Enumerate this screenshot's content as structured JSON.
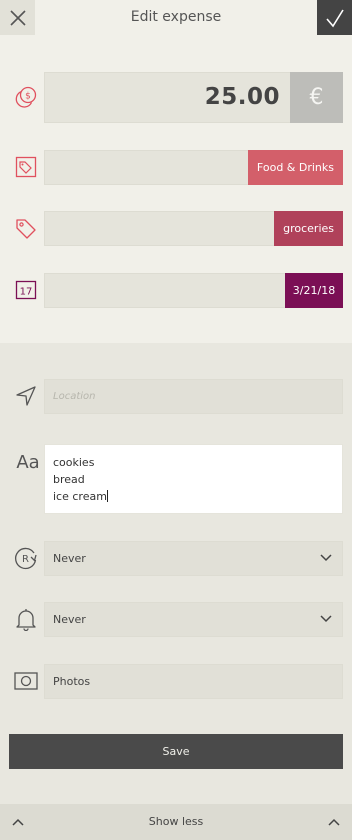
{
  "header": {
    "title": "Edit expense"
  },
  "amount": {
    "value": "25.00",
    "currency_symbol": "€"
  },
  "category": {
    "label": "Food & Drinks"
  },
  "tag": {
    "label": "groceries"
  },
  "date": {
    "label": "3/21/18"
  },
  "location": {
    "placeholder": "Location",
    "value": ""
  },
  "notes": {
    "icon_text": "Aa",
    "lines": [
      "cookies",
      "bread",
      "ice cream"
    ]
  },
  "repeat": {
    "icon_letter": "R",
    "value": "Never"
  },
  "reminder": {
    "value": "Never"
  },
  "photos": {
    "label": "Photos"
  },
  "save": {
    "label": "Save"
  },
  "footer": {
    "toggle_label": "Show less"
  },
  "colors": {
    "accent_red": "#e0505e",
    "category_pill": "#d35f6a",
    "tag_pill": "#b0415a",
    "date_pill": "#7b0f55",
    "confirm_bg": "#444444",
    "save_bg": "#4a4a4a"
  },
  "icons": {
    "close": "close-icon",
    "confirm": "checkmark-icon",
    "amount": "coins-icon",
    "category": "category-tag-icon",
    "tag": "tag-icon",
    "date": "calendar-icon",
    "location": "location-arrow-icon",
    "notes": "text-icon",
    "repeat": "repeat-icon",
    "reminder": "bell-icon",
    "photos": "camera-icon",
    "chevron": "chevron-down-icon"
  }
}
